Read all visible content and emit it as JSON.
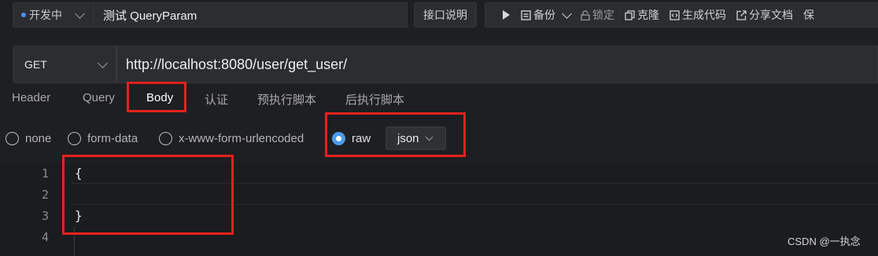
{
  "top": {
    "environment": "开发中",
    "request_name": "测试 QueryParam",
    "doc_button": "接口说明",
    "toolbar": {
      "backup": "备份",
      "lock": "锁定",
      "clone": "克隆",
      "generate_code": "生成代码",
      "share_doc": "分享文档",
      "save": "保"
    }
  },
  "request": {
    "method": "GET",
    "url": "http://localhost:8080/user/get_user/"
  },
  "tabs": [
    {
      "label": "Header"
    },
    {
      "label": "Query"
    },
    {
      "label": "Body",
      "active": true
    },
    {
      "label": "认证"
    },
    {
      "label": "预执行脚本"
    },
    {
      "label": "后执行脚本"
    }
  ],
  "body_types": {
    "options": [
      "none",
      "form-data",
      "x-www-form-urlencoded",
      "raw"
    ],
    "selected": "raw",
    "raw_format": "json"
  },
  "editor": {
    "line_numbers": [
      "1",
      "2",
      "3",
      "4"
    ],
    "lines": [
      "{",
      "",
      "}",
      ""
    ]
  },
  "watermark": "CSDN @一执念",
  "colors": {
    "accent": "#4a9bf0",
    "highlight": "#e5211e",
    "background": "#1e1f22"
  }
}
